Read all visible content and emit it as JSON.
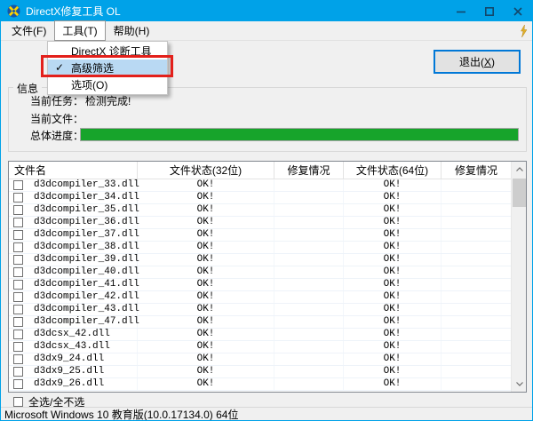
{
  "window": {
    "title": "DirectX修复工具 OL"
  },
  "menu_bar": {
    "items": [
      {
        "label": "文件(F)"
      },
      {
        "label": "工具(T)",
        "open": true
      },
      {
        "label": "帮助(H)"
      }
    ]
  },
  "tools_menu": {
    "items": [
      {
        "label": "DirectX 诊断工具",
        "checked": false
      },
      {
        "label": "高级筛选",
        "checked": true,
        "check_glyph": "✓",
        "highlighted": true,
        "annotated": true
      },
      {
        "label": "选项(O)",
        "checked": false
      }
    ]
  },
  "exit_button": {
    "text_before": "退出(",
    "mnemonic": "X",
    "text_after": ")"
  },
  "info_panel": {
    "title": "信息",
    "rows": [
      {
        "label": "当前任务：",
        "value": "检测完成!"
      },
      {
        "label": "当前文件：",
        "value": ""
      },
      {
        "label": "总体进度：",
        "value": ""
      }
    ],
    "progress_percent": 100
  },
  "file_table": {
    "columns": [
      "文件名",
      "文件状态(32位)",
      "修复情况",
      "文件状态(64位)",
      "修复情况"
    ],
    "rows": [
      {
        "name": "d3dcompiler_33.dll",
        "checked": false,
        "status32": "OK!",
        "fix32": "",
        "status64": "OK!",
        "fix64": ""
      },
      {
        "name": "d3dcompiler_34.dll",
        "checked": false,
        "status32": "OK!",
        "fix32": "",
        "status64": "OK!",
        "fix64": ""
      },
      {
        "name": "d3dcompiler_35.dll",
        "checked": false,
        "status32": "OK!",
        "fix32": "",
        "status64": "OK!",
        "fix64": ""
      },
      {
        "name": "d3dcompiler_36.dll",
        "checked": false,
        "status32": "OK!",
        "fix32": "",
        "status64": "OK!",
        "fix64": ""
      },
      {
        "name": "d3dcompiler_37.dll",
        "checked": false,
        "status32": "OK!",
        "fix32": "",
        "status64": "OK!",
        "fix64": ""
      },
      {
        "name": "d3dcompiler_38.dll",
        "checked": false,
        "status32": "OK!",
        "fix32": "",
        "status64": "OK!",
        "fix64": ""
      },
      {
        "name": "d3dcompiler_39.dll",
        "checked": false,
        "status32": "OK!",
        "fix32": "",
        "status64": "OK!",
        "fix64": ""
      },
      {
        "name": "d3dcompiler_40.dll",
        "checked": false,
        "status32": "OK!",
        "fix32": "",
        "status64": "OK!",
        "fix64": ""
      },
      {
        "name": "d3dcompiler_41.dll",
        "checked": false,
        "status32": "OK!",
        "fix32": "",
        "status64": "OK!",
        "fix64": ""
      },
      {
        "name": "d3dcompiler_42.dll",
        "checked": false,
        "status32": "OK!",
        "fix32": "",
        "status64": "OK!",
        "fix64": ""
      },
      {
        "name": "d3dcompiler_43.dll",
        "checked": false,
        "status32": "OK!",
        "fix32": "",
        "status64": "OK!",
        "fix64": ""
      },
      {
        "name": "d3dcompiler_47.dll",
        "checked": false,
        "status32": "OK!",
        "fix32": "",
        "status64": "OK!",
        "fix64": ""
      },
      {
        "name": "d3dcsx_42.dll",
        "checked": false,
        "status32": "OK!",
        "fix32": "",
        "status64": "OK!",
        "fix64": ""
      },
      {
        "name": "d3dcsx_43.dll",
        "checked": false,
        "status32": "OK!",
        "fix32": "",
        "status64": "OK!",
        "fix64": ""
      },
      {
        "name": "d3dx9_24.dll",
        "checked": false,
        "status32": "OK!",
        "fix32": "",
        "status64": "OK!",
        "fix64": ""
      },
      {
        "name": "d3dx9_25.dll",
        "checked": false,
        "status32": "OK!",
        "fix32": "",
        "status64": "OK!",
        "fix64": ""
      },
      {
        "name": "d3dx9_26.dll",
        "checked": false,
        "status32": "OK!",
        "fix32": "",
        "status64": "OK!",
        "f64": "",
        "fix64": ""
      }
    ]
  },
  "select_all": {
    "label": "全选/全不选",
    "checked": false
  },
  "status_bar": {
    "text": "Microsoft Windows 10 教育版(10.0.17134.0) 64位"
  },
  "colors": {
    "titlebar": "#00a2e8",
    "progress_green": "#17a42b",
    "annotation_red": "#e3201b",
    "menu_highlight": "#b9d9f3"
  }
}
